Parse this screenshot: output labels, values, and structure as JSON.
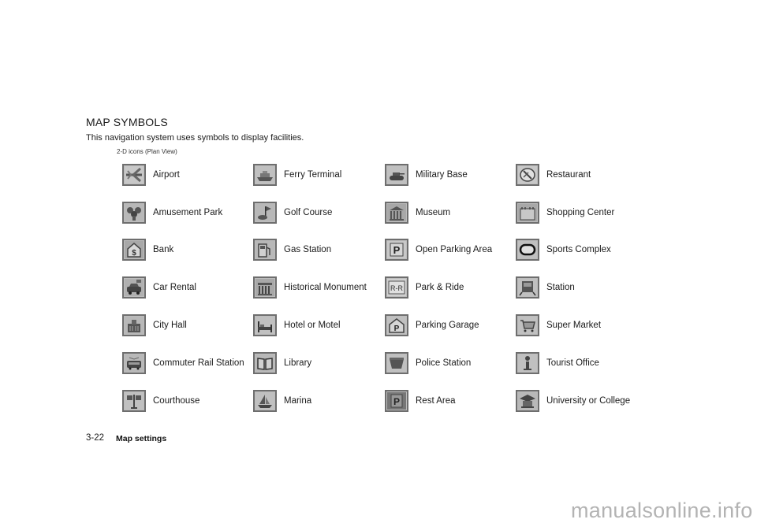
{
  "page": {
    "title": "MAP SYMBOLS",
    "subtitle": "This navigation system uses symbols to display facilities.",
    "caption": "2-D icons (Plan View)"
  },
  "columns": [
    {
      "items": [
        {
          "label": "Airport",
          "icon": "airport-icon"
        },
        {
          "label": "Amusement Park",
          "icon": "amusement-park-icon"
        },
        {
          "label": "Bank",
          "icon": "bank-icon"
        },
        {
          "label": "Car Rental",
          "icon": "car-rental-icon"
        },
        {
          "label": "City Hall",
          "icon": "city-hall-icon"
        },
        {
          "label": "Commuter Rail Station",
          "icon": "commuter-rail-icon"
        },
        {
          "label": "Courthouse",
          "icon": "courthouse-icon"
        }
      ]
    },
    {
      "items": [
        {
          "label": "Ferry Terminal",
          "icon": "ferry-terminal-icon"
        },
        {
          "label": "Golf Course",
          "icon": "golf-course-icon"
        },
        {
          "label": "Gas Station",
          "icon": "gas-station-icon"
        },
        {
          "label": "Historical Monument",
          "icon": "historical-monument-icon"
        },
        {
          "label": "Hotel or Motel",
          "icon": "hotel-icon"
        },
        {
          "label": "Library",
          "icon": "library-icon"
        },
        {
          "label": "Marina",
          "icon": "marina-icon"
        }
      ]
    },
    {
      "items": [
        {
          "label": "Military Base",
          "icon": "military-base-icon"
        },
        {
          "label": "Museum",
          "icon": "museum-icon"
        },
        {
          "label": "Open Parking Area",
          "icon": "open-parking-icon"
        },
        {
          "label": "Park & Ride",
          "icon": "park-and-ride-icon"
        },
        {
          "label": "Parking Garage",
          "icon": "parking-garage-icon"
        },
        {
          "label": "Police Station",
          "icon": "police-station-icon"
        },
        {
          "label": "Rest Area",
          "icon": "rest-area-icon"
        }
      ]
    },
    {
      "items": [
        {
          "label": "Restaurant",
          "icon": "restaurant-icon"
        },
        {
          "label": "Shopping Center",
          "icon": "shopping-center-icon"
        },
        {
          "label": "Sports Complex",
          "icon": "sports-complex-icon"
        },
        {
          "label": "Station",
          "icon": "station-icon"
        },
        {
          "label": "Super Market",
          "icon": "supermarket-icon"
        },
        {
          "label": "Tourist Office",
          "icon": "tourist-office-icon"
        },
        {
          "label": "University or College",
          "icon": "university-icon"
        }
      ]
    }
  ],
  "footer": {
    "page_number": "3-22",
    "section": "Map settings"
  },
  "watermark": "manualsonline.info"
}
